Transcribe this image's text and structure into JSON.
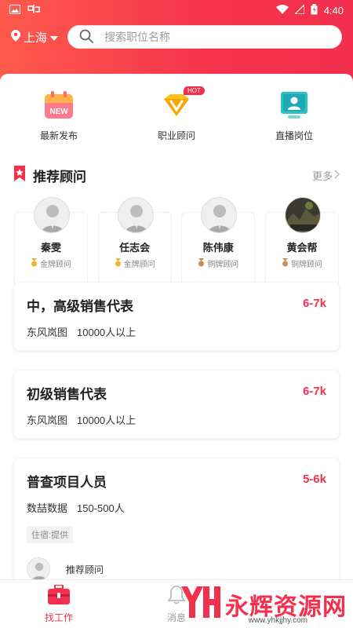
{
  "status_bar": {
    "time": "4:40"
  },
  "header": {
    "city": "上海",
    "search_placeholder": "搜索职位名称"
  },
  "quick_links": [
    {
      "label": "最新发布",
      "icon": "calendar-new-icon",
      "badge": "NEW"
    },
    {
      "label": "职业顾问",
      "icon": "vip-crown-icon",
      "badge": "HOT"
    },
    {
      "label": "直播岗位",
      "icon": "live-screen-icon"
    }
  ],
  "advisors_section": {
    "title": "推荐顾问",
    "more_label": "更多"
  },
  "advisors": [
    {
      "name": "秦雯",
      "level": "金牌顾问"
    },
    {
      "name": "任志会",
      "level": "金牌顾问"
    },
    {
      "name": "陈伟康",
      "level": "铜牌顾问"
    },
    {
      "name": "黄会帮",
      "level": "铜牌顾问"
    }
  ],
  "jobs": [
    {
      "title": "中，高级销售代表",
      "salary": "6-7k",
      "company": "东风岚图",
      "size": "10000人以上"
    },
    {
      "title": "初级销售代表",
      "salary": "6-7k",
      "company": "东风岚图",
      "size": "10000人以上"
    },
    {
      "title": "普查项目人员",
      "salary": "5-6k",
      "company": "数喆数据",
      "size": "150-500人",
      "tag": "住宿:提供",
      "advisor_label": "推荐顾问"
    }
  ],
  "bottom_nav": [
    {
      "label": "找工作",
      "active": true
    },
    {
      "label": "消息",
      "active": false
    }
  ],
  "watermark": {
    "brand": "永辉资源网",
    "url": "www.yhkjjhy.com"
  },
  "colors": {
    "brand_red": "#f3304d",
    "gold": "#f0b52c",
    "bronze": "#d08a50"
  }
}
